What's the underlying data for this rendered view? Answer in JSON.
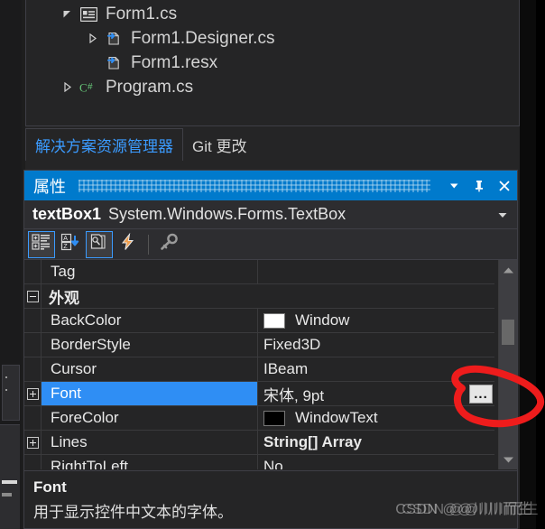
{
  "solution_explorer": {
    "tree": [
      {
        "indent": 0,
        "arrow": "expanded",
        "icon": "form-icon",
        "label": "Form1.cs"
      },
      {
        "indent": 1,
        "arrow": "collapsed",
        "icon": "cs-file-icon",
        "label": "Form1.Designer.cs"
      },
      {
        "indent": 1,
        "arrow": "none",
        "icon": "cs-file-icon",
        "label": "Form1.resx"
      },
      {
        "indent": 0,
        "arrow": "collapsed",
        "icon": "csharp-icon",
        "label": "Program.cs"
      }
    ]
  },
  "tabs": [
    {
      "label": "解决方案资源管理器",
      "active": true
    },
    {
      "label": "Git 更改",
      "active": false
    }
  ],
  "properties_window": {
    "title": "属性",
    "titlebar_buttons": [
      {
        "name": "dropdown",
        "icon": "chevron-down-icon"
      },
      {
        "name": "pin",
        "icon": "pin-icon"
      },
      {
        "name": "close",
        "icon": "close-icon"
      }
    ],
    "object": {
      "name": "textBox1",
      "type": "System.Windows.Forms.TextBox"
    },
    "toolbar": [
      {
        "name": "categorized-button",
        "icon": "categorized-icon",
        "selected": true
      },
      {
        "name": "alphabetical-button",
        "icon": "sort-az-icon",
        "selected": false
      },
      {
        "name": "properties-button",
        "icon": "properties-page-icon",
        "selected": true
      },
      {
        "name": "events-button",
        "icon": "lightning-icon",
        "selected": false
      },
      {
        "name": "property-pages-button",
        "icon": "key-icon",
        "selected": false
      }
    ],
    "grid": {
      "rows": [
        {
          "kind": "property",
          "expander": "none",
          "name": "Tag",
          "value": "",
          "swatch": null,
          "bold": false,
          "selected": false
        },
        {
          "kind": "category",
          "expander": "minus",
          "name": "外观",
          "value": "",
          "swatch": null,
          "bold": false,
          "selected": false
        },
        {
          "kind": "property",
          "expander": "none",
          "name": "BackColor",
          "value": "Window",
          "swatch": "#ffffff",
          "bold": false,
          "selected": false
        },
        {
          "kind": "property",
          "expander": "none",
          "name": "BorderStyle",
          "value": "Fixed3D",
          "swatch": null,
          "bold": false,
          "selected": false
        },
        {
          "kind": "property",
          "expander": "none",
          "name": "Cursor",
          "value": "IBeam",
          "swatch": null,
          "bold": false,
          "selected": false
        },
        {
          "kind": "property",
          "expander": "plus",
          "name": "Font",
          "value": "宋体, 9pt",
          "swatch": null,
          "bold": false,
          "selected": true,
          "ellipsis_button": "..."
        },
        {
          "kind": "property",
          "expander": "none",
          "name": "ForeColor",
          "value": "WindowText",
          "swatch": "#000000",
          "bold": false,
          "selected": false
        },
        {
          "kind": "property",
          "expander": "plus",
          "name": "Lines",
          "value": "String[] Array",
          "swatch": null,
          "bold": true,
          "selected": false
        },
        {
          "kind": "property",
          "expander": "none",
          "name": "RightToLeft",
          "value": "No",
          "swatch": null,
          "bold": false,
          "selected": false
        }
      ]
    },
    "description": {
      "title": "Font",
      "text": "用于显示控件中文本的字体。"
    }
  },
  "watermark": "CSDN @@川川而生",
  "colors": {
    "accent": "#007acc",
    "selection": "#2f8ef4",
    "link": "#3b9bff",
    "panel_bg": "#252526",
    "toolbar_bg": "#2d2d30",
    "border": "#3f3f46",
    "annotation": "#ee1c1c"
  }
}
